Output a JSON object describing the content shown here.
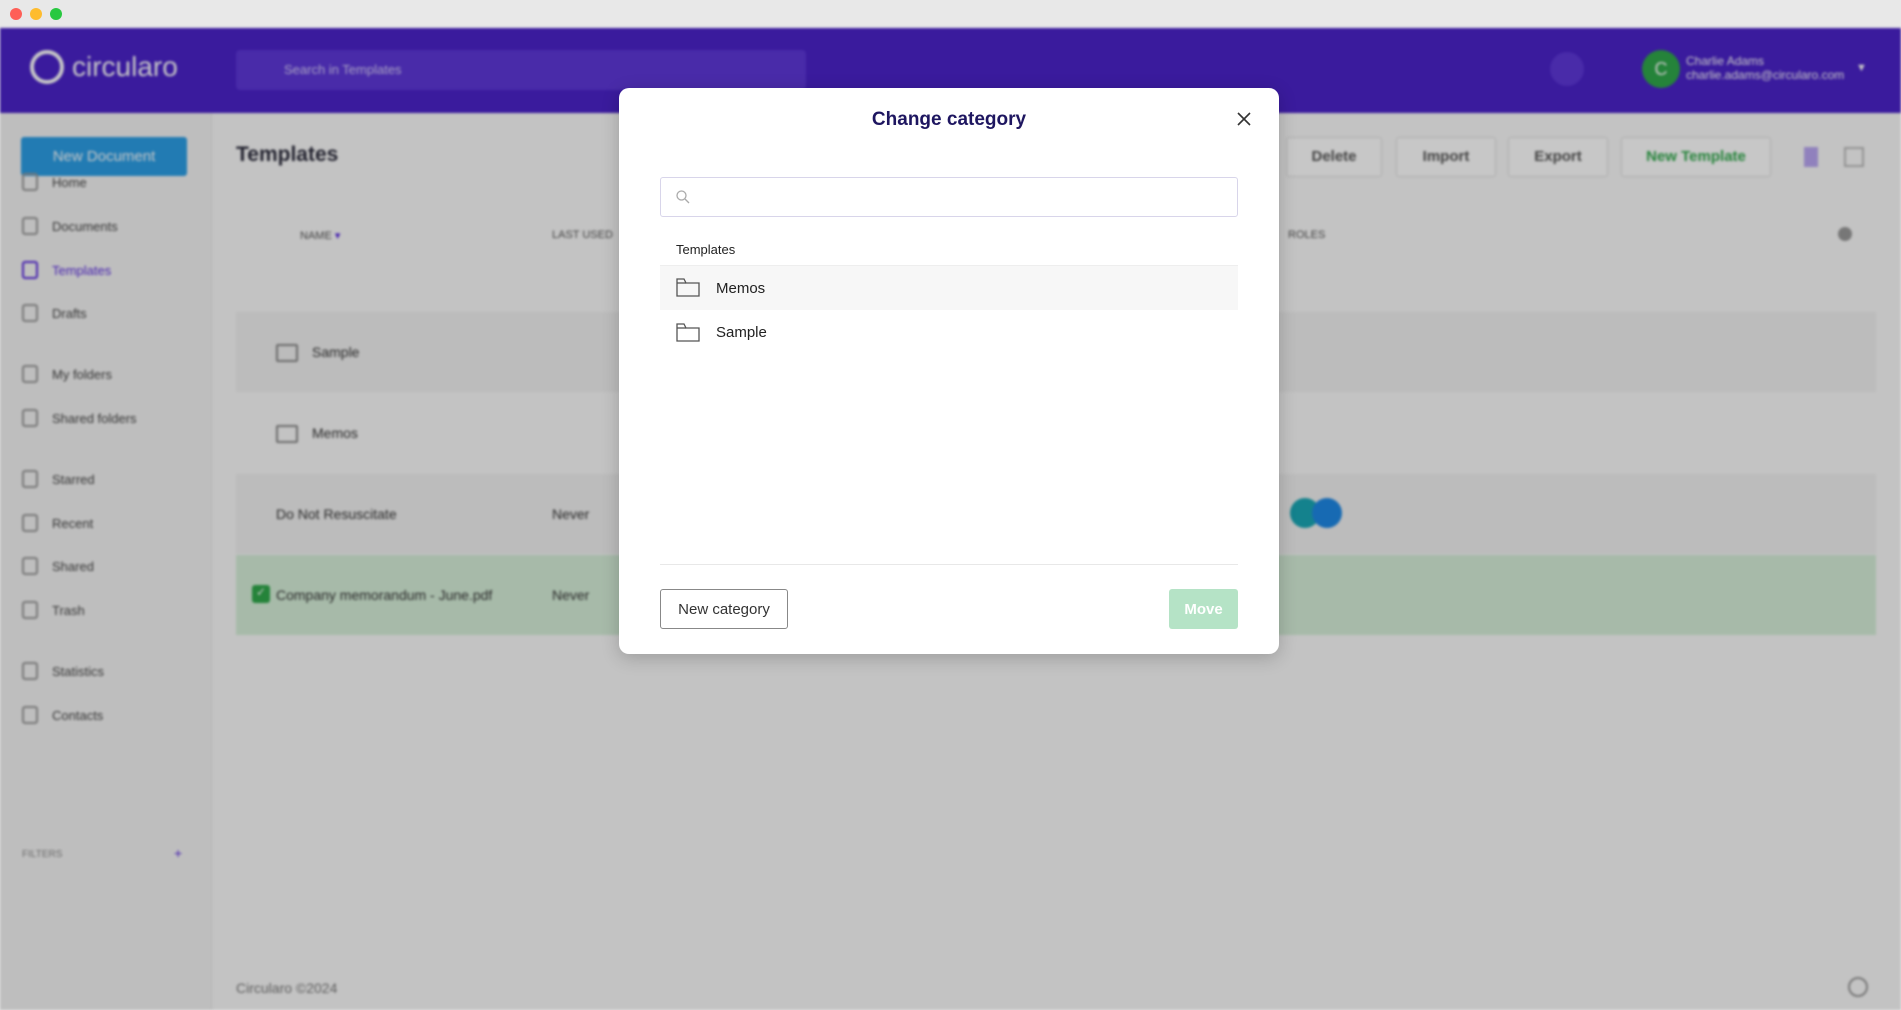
{
  "window": {
    "controls": [
      "close",
      "minimize",
      "maximize"
    ]
  },
  "header": {
    "brand": "circularo",
    "search_placeholder": "Search in Templates",
    "user_initial": "C",
    "user_name": "Charlie Adams",
    "user_email": "charlie.adams@circularo.com"
  },
  "sidebar": {
    "new_document": "New Document",
    "items": [
      {
        "label": "Home",
        "icon": "home-icon"
      },
      {
        "label": "Documents",
        "icon": "document-icon"
      },
      {
        "label": "Templates",
        "icon": "template-icon",
        "active": true
      },
      {
        "label": "Drafts",
        "icon": "edit-icon"
      },
      {
        "label": "My folders",
        "icon": "folder-icon"
      },
      {
        "label": "Shared folders",
        "icon": "shared-folder-icon"
      },
      {
        "label": "Starred",
        "icon": "star-icon"
      },
      {
        "label": "Recent",
        "icon": "clock-icon"
      },
      {
        "label": "Shared",
        "icon": "share-icon"
      },
      {
        "label": "Trash",
        "icon": "trash-icon"
      },
      {
        "label": "Statistics",
        "icon": "chart-icon"
      },
      {
        "label": "Contacts",
        "icon": "contacts-icon"
      }
    ],
    "filters": "FILTERS",
    "filters_add": "+"
  },
  "main": {
    "title": "Templates",
    "toolbar": {
      "delete": "Delete",
      "import": "Import",
      "export": "Export",
      "new_template": "New Template"
    },
    "columns": {
      "name": "NAME",
      "last_used": "LAST USED",
      "roles": "ROLES"
    },
    "rows": [
      {
        "name": "Sample",
        "type": "folder"
      },
      {
        "name": "Memos",
        "type": "folder"
      },
      {
        "name": "Do Not Resuscitate",
        "last_used": "Never"
      },
      {
        "name": "Company memorandum - June.pdf",
        "last_used": "Never",
        "selected": true
      }
    ],
    "footer": "Circularo ©2024"
  },
  "modal": {
    "title": "Change category",
    "search_value": "",
    "section": "Templates",
    "items": [
      {
        "label": "Memos",
        "highlighted": true
      },
      {
        "label": "Sample"
      }
    ],
    "new_category": "New category",
    "move": "Move"
  },
  "colors": {
    "brand": "#4a22c9",
    "accent_green": "#2fa84a",
    "move_disabled": "#b5e3c6",
    "title": "#1e1660"
  }
}
